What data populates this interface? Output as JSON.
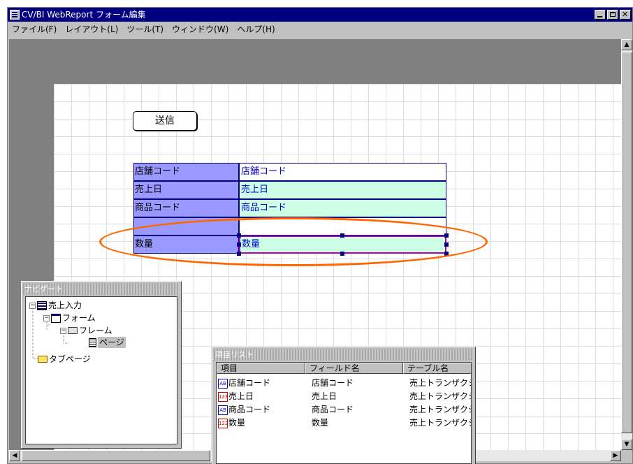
{
  "window": {
    "title": "CV/BI WebReport フォーム編集"
  },
  "menu": [
    "ファイル(F)",
    "レイアウト(L)",
    "ツール(T)",
    "ウィンドウ(W)",
    "ヘルプ(H)"
  ],
  "canvas": {
    "send_button": "送信",
    "rows": [
      {
        "label": "店舗コード",
        "value": "店舗コード",
        "bg": "#ffffff"
      },
      {
        "label": "売上日",
        "value": "売上日",
        "bg": "#ccffe6"
      },
      {
        "label": "商品コード",
        "value": "商品コード",
        "bg": "#ccffe6"
      },
      {
        "label": "",
        "value": "",
        "bg": "#ffffff"
      },
      {
        "label": "数量",
        "value": "数量",
        "bg": "#ccffe6"
      }
    ],
    "highlight_color": "#ff6600"
  },
  "navigator": {
    "title": "ナビゲート",
    "nodes": [
      {
        "label": "売上入力",
        "icon": "form-icon"
      },
      {
        "label": "フォーム",
        "icon": "window-icon"
      },
      {
        "label": "フレーム",
        "icon": "frame-icon"
      },
      {
        "label": "ページ",
        "icon": "page-icon"
      },
      {
        "label": "タブページ",
        "icon": "folder-icon"
      }
    ]
  },
  "item_list": {
    "title": "項目リスト",
    "headers": [
      "項目",
      "フィールド名",
      "テーブル名"
    ],
    "rows": [
      {
        "type": "AB",
        "item": "店舗コード",
        "field": "店舗コード",
        "table": "売上トランザクション"
      },
      {
        "type": "123",
        "item": "売上日",
        "field": "売上日",
        "table": "売上トランザクション"
      },
      {
        "type": "AB",
        "item": "商品コード",
        "field": "商品コード",
        "table": "売上トランザクション"
      },
      {
        "type": "123",
        "item": "数量",
        "field": "数量",
        "table": "売上トランザクション"
      }
    ]
  }
}
